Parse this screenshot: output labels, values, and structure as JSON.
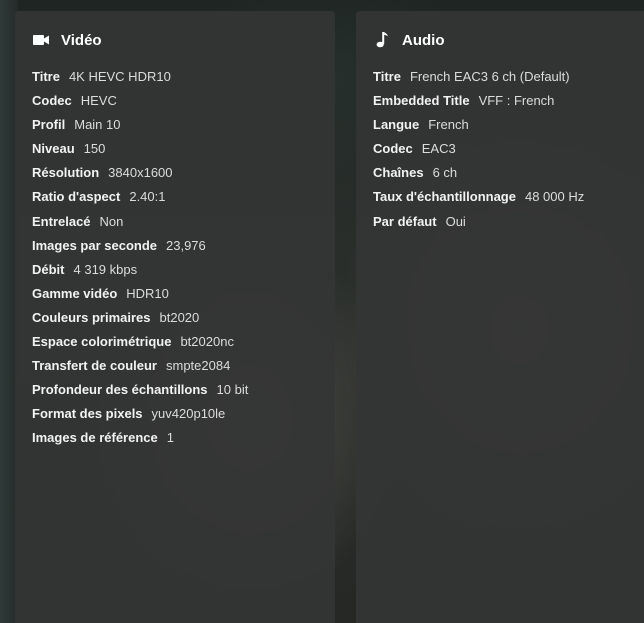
{
  "video": {
    "title": "Vidéo",
    "icon": "video-camera-icon",
    "rows": [
      {
        "label": "Titre",
        "value": "4K HEVC HDR10"
      },
      {
        "label": "Codec",
        "value": "HEVC"
      },
      {
        "label": "Profil",
        "value": "Main 10"
      },
      {
        "label": "Niveau",
        "value": "150"
      },
      {
        "label": "Résolution",
        "value": "3840x1600"
      },
      {
        "label": "Ratio d'aspect",
        "value": "2.40:1"
      },
      {
        "label": "Entrelacé",
        "value": "Non"
      },
      {
        "label": "Images par seconde",
        "value": "23,976"
      },
      {
        "label": "Débit",
        "value": "4 319 kbps"
      },
      {
        "label": "Gamme vidéo",
        "value": "HDR10"
      },
      {
        "label": "Couleurs primaires",
        "value": "bt2020"
      },
      {
        "label": "Espace colorimétrique",
        "value": "bt2020nc"
      },
      {
        "label": "Transfert de couleur",
        "value": "smpte2084"
      },
      {
        "label": "Profondeur des échantillons",
        "value": "10 bit"
      },
      {
        "label": "Format des pixels",
        "value": "yuv420p10le"
      },
      {
        "label": "Images de référence",
        "value": "1"
      }
    ]
  },
  "audio": {
    "title": "Audio",
    "icon": "music-note-icon",
    "rows": [
      {
        "label": "Titre",
        "value": "French EAC3 6 ch (Default)"
      },
      {
        "label": "Embedded Title",
        "value": "VFF : French"
      },
      {
        "label": "Langue",
        "value": "French"
      },
      {
        "label": "Codec",
        "value": "EAC3"
      },
      {
        "label": "Chaînes",
        "value": "6 ch"
      },
      {
        "label": "Taux d'échantillonnage",
        "value": "48 000 Hz"
      },
      {
        "label": "Par défaut",
        "value": "Oui"
      }
    ]
  },
  "colors": {
    "panel_bg": "#343535",
    "label": "#f2f2f2",
    "value": "#dcdcdc"
  }
}
